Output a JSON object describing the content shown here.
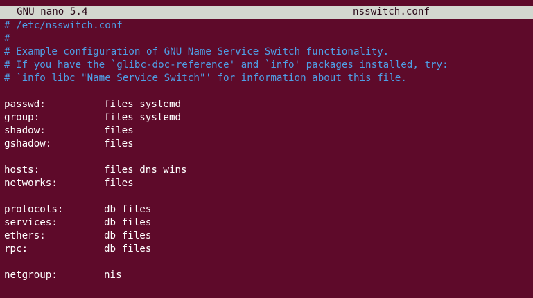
{
  "colors": {
    "background": "#5e0a2a",
    "titlebar_bg": "#d3d7cf",
    "comment": "#4f9fe6",
    "text": "#ffffff"
  },
  "titlebar": {
    "app_version": "GNU nano 5.4",
    "file_name": "nsswitch.conf"
  },
  "comments": [
    "# /etc/nsswitch.conf",
    "#",
    "# Example configuration of GNU Name Service Switch functionality.",
    "# If you have the `glibc-doc-reference' and `info' packages installed, try:",
    "# `info libc \"Name Service Switch\"' for information about this file."
  ],
  "entries": {
    "passwd": {
      "key": "passwd:",
      "value": "files systemd"
    },
    "group": {
      "key": "group:",
      "value": "files systemd"
    },
    "shadow": {
      "key": "shadow:",
      "value": "files"
    },
    "gshadow": {
      "key": "gshadow:",
      "value": "files"
    },
    "hosts": {
      "key": "hosts:",
      "value": "files dns wins"
    },
    "networks": {
      "key": "networks:",
      "value": "files"
    },
    "protocols": {
      "key": "protocols:",
      "value": "db files"
    },
    "services": {
      "key": "services:",
      "value": "db files"
    },
    "ethers": {
      "key": "ethers:",
      "value": "db files"
    },
    "rpc": {
      "key": "rpc:",
      "value": "db files"
    },
    "netgroup": {
      "key": "netgroup:",
      "value": "nis"
    }
  }
}
